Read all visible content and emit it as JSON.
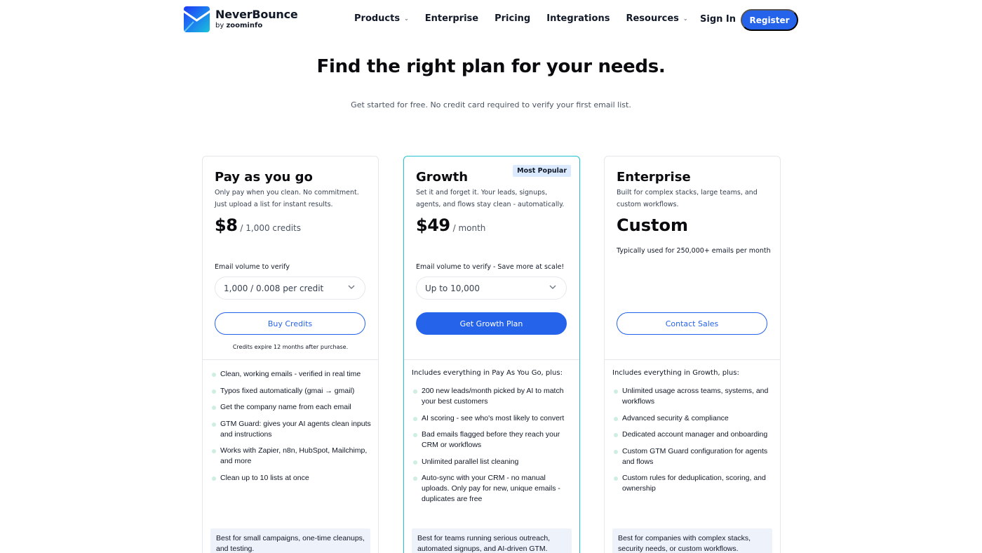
{
  "header": {
    "brand_name": "NeverBounce",
    "brand_by": "by",
    "brand_parent": "zoominfo",
    "nav": [
      {
        "label": "Products",
        "has_dropdown": true
      },
      {
        "label": "Enterprise",
        "has_dropdown": false
      },
      {
        "label": "Pricing",
        "has_dropdown": false
      },
      {
        "label": "Integrations",
        "has_dropdown": false
      },
      {
        "label": "Resources",
        "has_dropdown": true
      }
    ],
    "signin": "Sign In",
    "register": "Register"
  },
  "hero": {
    "title": "Find the right plan for your needs.",
    "subtitle": "Get started for free. No credit card required to verify your first email list."
  },
  "plans": [
    {
      "name": "Pay as you go",
      "desc": "Only pay when you clean. No commitment. Just upload a list for instant results.",
      "price": "$8",
      "price_unit": "/ 1,000 credits",
      "volume_label": "Email volume to verify",
      "volume_value": "1,000 / 0.008 per credit",
      "cta": "Buy Credits",
      "footnote": "Credits expire 12 months after purchase.",
      "features_intro": "",
      "features": [
        "Clean, working emails - verified in real time",
        "Typos fixed automatically (gmai → gmail)",
        "Get the company name from each email",
        "GTM Guard: gives your AI agents clean inputs and instructions",
        "Works with Zapier, n8n, HubSpot, Mailchimp, and more",
        "Clean up to 10 lists at once"
      ],
      "best_for": "Best for small campaigns, one-time cleanups, and testing."
    },
    {
      "name": "Growth",
      "badge": "Most Popular",
      "desc": "Set it and forget it. Your leads, signups, agents, and flows stay clean - automatically.",
      "price": "$49",
      "price_unit": "/ month",
      "volume_label": "Email volume to verify - Save more at scale!",
      "volume_value": "Up to 10,000",
      "cta": "Get Growth Plan",
      "features_intro": "Includes everything in Pay As You Go, plus:",
      "features": [
        "200 new leads/month picked by AI to match your best customers",
        "AI scoring - see who's most likely to convert",
        "Bad emails flagged before they reach your CRM or workflows",
        "Unlimited parallel list cleaning",
        "Auto-sync with your CRM - no manual uploads. Only pay for new, unique emails - duplicates are free"
      ],
      "best_for": "Best for teams running serious outreach, automated signups, and AI-driven GTM."
    },
    {
      "name": "Enterprise",
      "desc": "Built for complex stacks, large teams, and custom workflows.",
      "price_custom": "Custom",
      "custom_note": "Typically used for 250,000+ emails per month",
      "cta": "Contact Sales",
      "features_intro": "Includes everything in Growth, plus:",
      "features": [
        "Unlimited usage across teams, systems, and workflows",
        "Advanced security & compliance",
        "Dedicated account manager and onboarding",
        "Custom GTM Guard configuration for agents and flows",
        "Custom rules for deduplication, scoring, and ownership"
      ],
      "best_for": "Best for companies with complex stacks, security needs, or custom workflows."
    }
  ]
}
